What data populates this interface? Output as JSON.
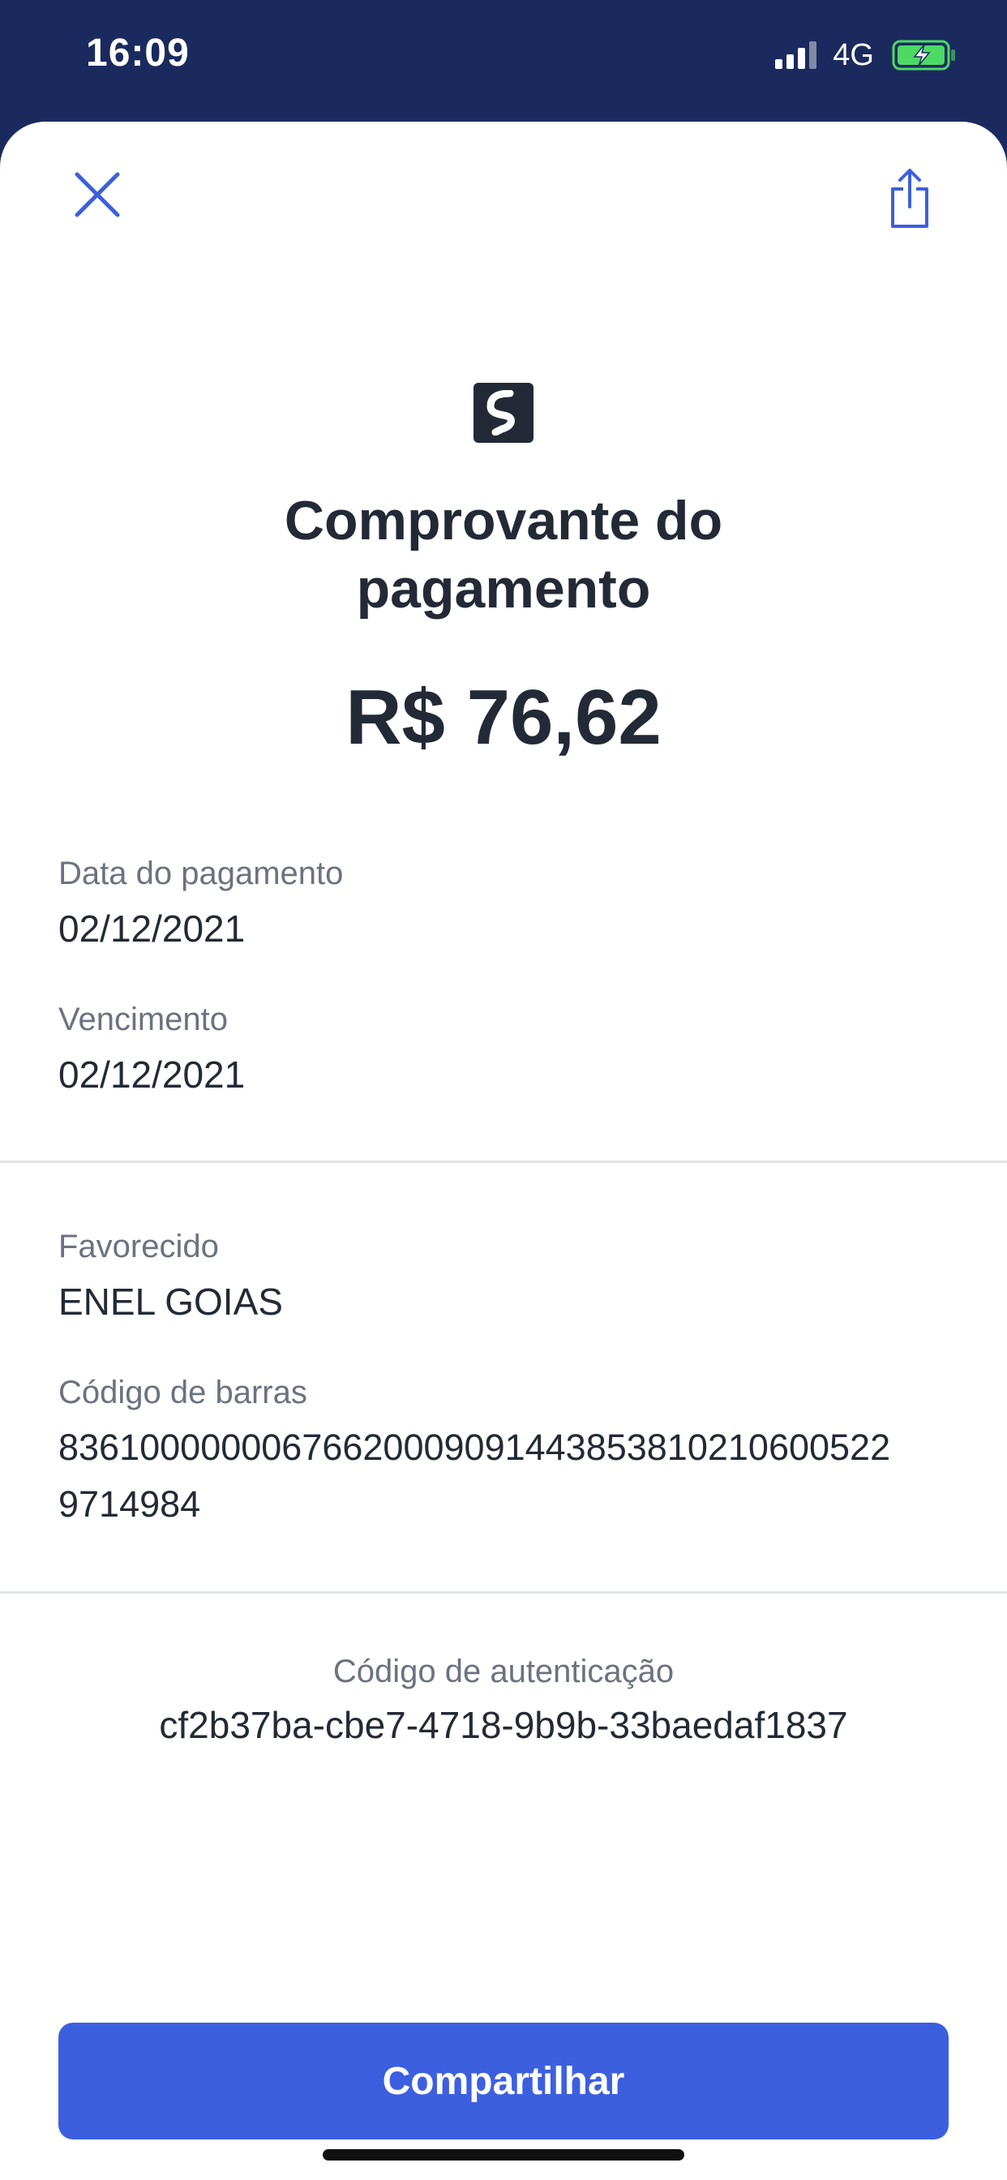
{
  "status_bar": {
    "time": "16:09",
    "network": "4G",
    "battery_color": "#4cd964"
  },
  "header": {
    "close_icon": "close-icon",
    "share_icon": "share-upload-icon",
    "accent_color": "#3c5fe0"
  },
  "receipt": {
    "logo_icon": "bank-logo-icon",
    "title_line1": "Comprovante do",
    "title_line2": "pagamento",
    "amount": "R$ 76,62"
  },
  "dates": {
    "payment_label": "Data do pagamento",
    "payment_value": "02/12/2021",
    "due_label": "Vencimento",
    "due_value": "02/12/2021"
  },
  "payee": {
    "label": "Favorecido",
    "value": "ENEL GOIAS",
    "barcode_label": "Código de barras",
    "barcode_line1": "83610000000676620009091443853810210600522",
    "barcode_line2": "9714984"
  },
  "authentication": {
    "label": "Código de autenticação",
    "value": "cf2b37ba-cbe7-4718-9b9b-33baedaf1837"
  },
  "actions": {
    "share_label": "Compartilhar",
    "button_color": "#3c5fe0"
  }
}
